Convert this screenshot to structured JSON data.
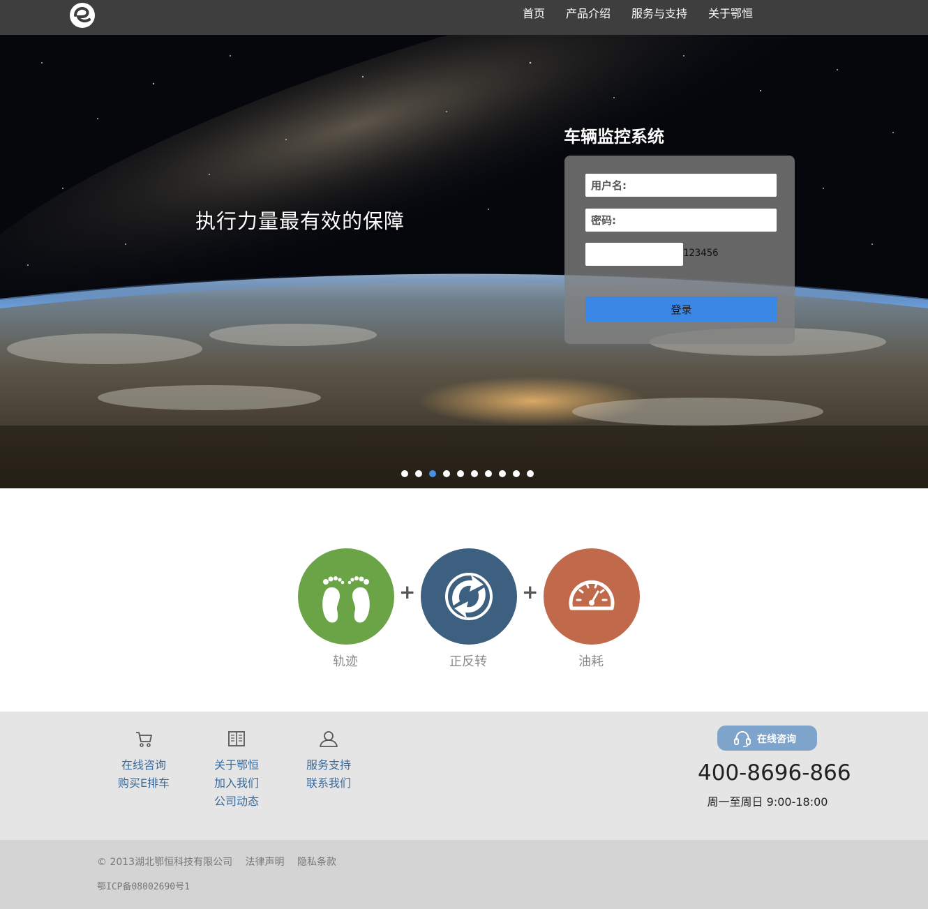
{
  "nav": {
    "items": [
      "首页",
      "产品介绍",
      "服务与支持",
      "关于鄂恒"
    ]
  },
  "hero": {
    "slogan": "执行力量最有效的保障",
    "login": {
      "title": "车辆监控系统",
      "username_placeholder": "用户名:",
      "password_placeholder": "密码:",
      "captcha_value": "123456",
      "submit_label": "登录"
    },
    "carousel": {
      "total": 10,
      "active_index": 2
    }
  },
  "features": {
    "items": [
      {
        "label": "轨迹",
        "color": "#6ba446",
        "icon": "footprints-icon"
      },
      {
        "label": "正反转",
        "color": "#3d5f80",
        "icon": "rotation-icon"
      },
      {
        "label": "油耗",
        "color": "#c06a4b",
        "icon": "speedometer-icon"
      }
    ],
    "separator": "+"
  },
  "footer": {
    "columns": [
      {
        "icon": "cart-icon",
        "links": [
          "在线咨询",
          "购买E排车"
        ]
      },
      {
        "icon": "book-icon",
        "links": [
          "关于鄂恒",
          "加入我们",
          "公司动态"
        ]
      },
      {
        "icon": "user-icon",
        "links": [
          "服务支持",
          "联系我们"
        ]
      }
    ],
    "consult_label": "在线咨询",
    "phone": "400-8696-866",
    "hours": "周一至周日 9:00-18:00",
    "copyright": "© 2013湖北鄂恒科技有限公司",
    "legal": "法律声明",
    "privacy": "隐私条款",
    "icp": "鄂ICP备08002690号1"
  },
  "colors": {
    "topbar": "#3e3e3e",
    "accent": "#3a87e6",
    "link": "#3b6a9a"
  }
}
